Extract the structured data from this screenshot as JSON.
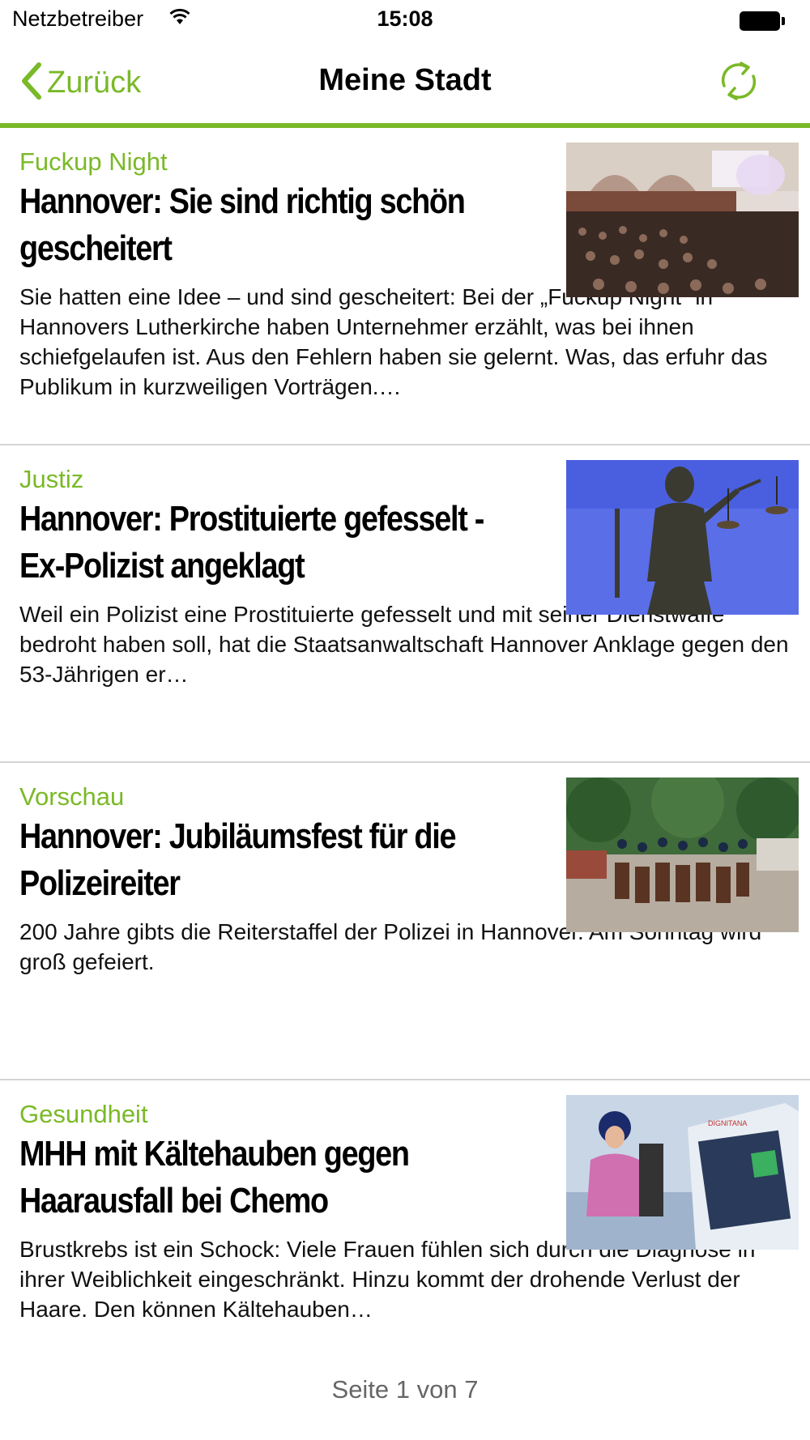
{
  "status_bar": {
    "carrier": "Netzbetreiber",
    "time": "15:08",
    "wifi_icon": "wifi-icon",
    "battery_icon": "battery-icon"
  },
  "nav": {
    "back_label": "Zurück",
    "title": "Meine Stadt",
    "refresh_icon": "refresh-icon",
    "accent_color": "#7ab927"
  },
  "articles": [
    {
      "category": "Fuckup Night",
      "headline": "Hannover: Sie sind richtig schön gescheitert",
      "teaser": "Sie hatten eine Idee – und sind gescheitert: Bei der „Fuckup Night“ in Hannovers Lutherkirche haben Unternehmer erzählt, was bei ihnen schiefgelaufen ist. Aus den Fehlern haben sie gelernt. Was, das erfuhr das Publikum in kurzweiligen Vorträgen.…",
      "image": "church-audience-photo"
    },
    {
      "category": "Justiz",
      "headline": "Hannover: Prostituierte gefesselt - Ex-Polizist angeklagt",
      "teaser": "Weil ein Polizist eine Prostituierte gefesselt und mit seiner Dienstwaffe bedroht haben soll, hat die Staatsanwaltschaft Hannover Anklage gegen den 53-Jährigen er…",
      "image": "justitia-statue-photo"
    },
    {
      "category": "Vorschau",
      "headline": "Hannover: Jubiläumsfest für die Polizeireiter",
      "teaser": "200 Jahre gibts die Reiterstaffel der Polizei in Hannover. Am Sonntag wird groß gefeiert.",
      "image": "mounted-police-photo"
    },
    {
      "category": "Gesundheit",
      "headline": "MHH mit Kältehauben gegen Haarausfall bei Chemo",
      "teaser": "Brustkrebs ist ein Schock: Viele Frauen fühlen sich durch die Diagnose in ihrer Weiblichkeit eingeschränkt. Hinzu kommt der drohende Verlust der Haare. Den können Kältehauben…",
      "image": "cooling-cap-device-photo",
      "device_brand": "DIGNITANA"
    }
  ],
  "pager": {
    "label": "Seite 1 von 7"
  }
}
